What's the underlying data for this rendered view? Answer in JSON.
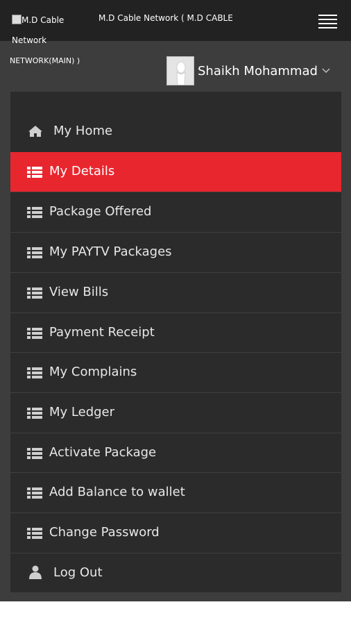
{
  "header": {
    "logo_alt_line1": "M.D Cable",
    "logo_alt_line2": "Network",
    "network_title": "M.D Cable Network ( M.D CABLE",
    "network_title_cont": "NETWORK(MAIN) )",
    "menu_icon": "hamburger-icon"
  },
  "user": {
    "name": "Shaikh Mohammad",
    "avatar_icon": "user-avatar-icon",
    "dropdown_icon": "chevron-down-icon"
  },
  "colors": {
    "accent": "#e8262e",
    "header_bg": "#222222",
    "page_bg": "#3d3d3d",
    "menu_bg": "#2b2b2b"
  },
  "menu": {
    "items": [
      {
        "label": "My Home",
        "icon": "home-icon"
      },
      {
        "label": "My Details",
        "icon": "list-icon",
        "active": true
      },
      {
        "label": "Package Offered",
        "icon": "list-icon"
      },
      {
        "label": "My PAYTV Packages",
        "icon": "list-icon"
      },
      {
        "label": "View Bills",
        "icon": "list-icon"
      },
      {
        "label": "Payment Receipt",
        "icon": "list-icon"
      },
      {
        "label": "My Complains",
        "icon": "list-icon"
      },
      {
        "label": "My Ledger",
        "icon": "list-icon"
      },
      {
        "label": "Activate Package",
        "icon": "list-icon"
      },
      {
        "label": "Add Balance to wallet",
        "icon": "list-icon"
      },
      {
        "label": "Change Password",
        "icon": "list-icon"
      },
      {
        "label": "Log Out",
        "icon": "person-icon"
      }
    ]
  }
}
